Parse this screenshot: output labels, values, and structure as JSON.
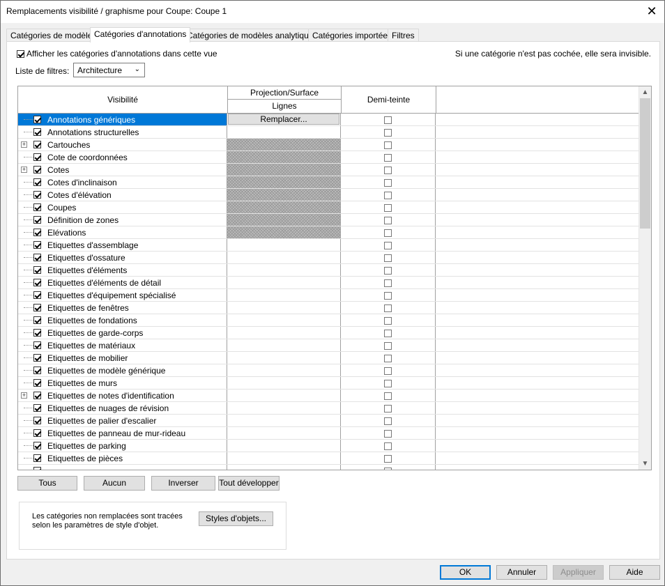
{
  "window": {
    "title": "Remplacements visibilité / graphisme pour Coupe: Coupe 1",
    "close_glyph": "✕"
  },
  "tabs": [
    {
      "label": "Catégories de modèles"
    },
    {
      "label": "Catégories d'annotations"
    },
    {
      "label": "Catégories de modèles analytiques"
    },
    {
      "label": "Catégories importées"
    },
    {
      "label": "Filtres"
    }
  ],
  "panel": {
    "show_annotations_label": "Afficher les catégories d'annotations dans cette vue",
    "hint": "Si une catégorie n'est pas cochée, elle sera invisible.",
    "filter_list_label": "Liste de filtres:",
    "filter_list_value": "Architecture"
  },
  "grid": {
    "header": {
      "visibility": "Visibilité",
      "projection_surface": "Projection/Surface",
      "lines": "Lignes",
      "halftone": "Demi-teinte"
    },
    "replace_button": "Remplacer...",
    "rows": [
      {
        "label": "Annotations génériques",
        "checked": true,
        "expander": false,
        "hatched": false,
        "selected": true
      },
      {
        "label": "Annotations structurelles",
        "checked": true,
        "expander": false,
        "hatched": false,
        "selected": false
      },
      {
        "label": "Cartouches",
        "checked": true,
        "expander": true,
        "hatched": true,
        "selected": false
      },
      {
        "label": "Cote de coordonnées",
        "checked": true,
        "expander": false,
        "hatched": true,
        "selected": false
      },
      {
        "label": "Cotes",
        "checked": true,
        "expander": true,
        "hatched": true,
        "selected": false
      },
      {
        "label": "Cotes d'inclinaison",
        "checked": true,
        "expander": false,
        "hatched": true,
        "selected": false
      },
      {
        "label": "Cotes d'élévation",
        "checked": true,
        "expander": false,
        "hatched": true,
        "selected": false
      },
      {
        "label": "Coupes",
        "checked": true,
        "expander": false,
        "hatched": true,
        "selected": false
      },
      {
        "label": "Définition de zones",
        "checked": true,
        "expander": false,
        "hatched": true,
        "selected": false
      },
      {
        "label": "Elévations",
        "checked": true,
        "expander": false,
        "hatched": true,
        "selected": false
      },
      {
        "label": "Etiquettes d'assemblage",
        "checked": true,
        "expander": false,
        "hatched": false,
        "selected": false
      },
      {
        "label": "Etiquettes d'ossature",
        "checked": true,
        "expander": false,
        "hatched": false,
        "selected": false
      },
      {
        "label": "Etiquettes d'éléments",
        "checked": true,
        "expander": false,
        "hatched": false,
        "selected": false
      },
      {
        "label": "Etiquettes d'éléments de détail",
        "checked": true,
        "expander": false,
        "hatched": false,
        "selected": false
      },
      {
        "label": "Etiquettes d'équipement spécialisé",
        "checked": true,
        "expander": false,
        "hatched": false,
        "selected": false
      },
      {
        "label": "Etiquettes de fenêtres",
        "checked": true,
        "expander": false,
        "hatched": false,
        "selected": false
      },
      {
        "label": "Etiquettes de fondations",
        "checked": true,
        "expander": false,
        "hatched": false,
        "selected": false
      },
      {
        "label": "Etiquettes de garde-corps",
        "checked": true,
        "expander": false,
        "hatched": false,
        "selected": false
      },
      {
        "label": "Etiquettes de matériaux",
        "checked": true,
        "expander": false,
        "hatched": false,
        "selected": false
      },
      {
        "label": "Etiquettes de mobilier",
        "checked": true,
        "expander": false,
        "hatched": false,
        "selected": false
      },
      {
        "label": "Etiquettes de modèle générique",
        "checked": true,
        "expander": false,
        "hatched": false,
        "selected": false
      },
      {
        "label": "Etiquettes de murs",
        "checked": true,
        "expander": false,
        "hatched": false,
        "selected": false
      },
      {
        "label": "Etiquettes de notes d'identification",
        "checked": true,
        "expander": true,
        "hatched": false,
        "selected": false
      },
      {
        "label": "Etiquettes de nuages de révision",
        "checked": true,
        "expander": false,
        "hatched": false,
        "selected": false
      },
      {
        "label": "Etiquettes de palier d'escalier",
        "checked": true,
        "expander": false,
        "hatched": false,
        "selected": false
      },
      {
        "label": "Etiquettes de panneau de mur-rideau",
        "checked": true,
        "expander": false,
        "hatched": false,
        "selected": false
      },
      {
        "label": "Etiquettes de parking",
        "checked": true,
        "expander": false,
        "hatched": false,
        "selected": false
      },
      {
        "label": "Etiquettes de pièces",
        "checked": true,
        "expander": false,
        "hatched": false,
        "selected": false
      },
      {
        "label": "",
        "checked": true,
        "expander": false,
        "hatched": false,
        "selected": false
      }
    ]
  },
  "grid_buttons": {
    "all": "Tous",
    "none": "Aucun",
    "invert": "Inverser",
    "expand_all": "Tout développer"
  },
  "info": {
    "text": "Les catégories non remplacées sont tracées selon les paramètres de style d'objet.",
    "object_styles_button": "Styles d'objets..."
  },
  "footer": {
    "ok": "OK",
    "cancel": "Annuler",
    "apply": "Appliquer",
    "help": "Aide"
  },
  "colors": {
    "selection": "#0078d7",
    "default_button_border": "#0078d7"
  }
}
